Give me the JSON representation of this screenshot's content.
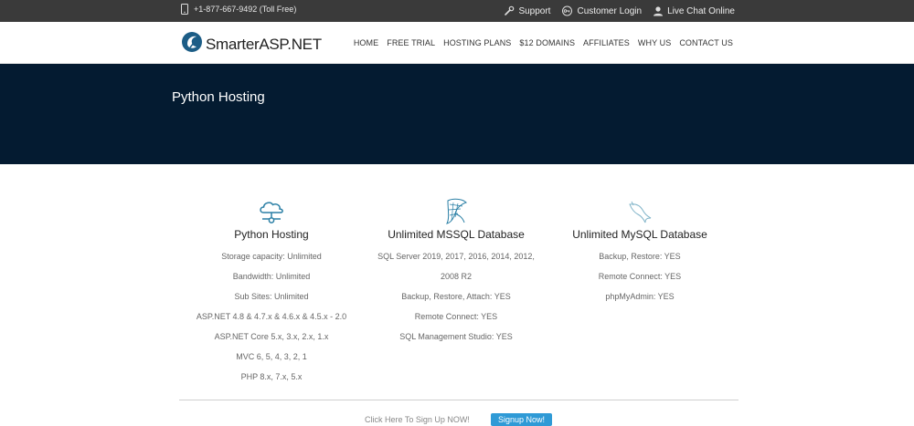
{
  "topbar": {
    "phone": "+1-877-667-9492 (Toll Free)",
    "links": [
      {
        "label": "Support",
        "icon": "wrench-icon"
      },
      {
        "label": "Customer Login",
        "icon": "key-icon"
      },
      {
        "label": "Live Chat Online",
        "icon": "user-icon"
      }
    ]
  },
  "header": {
    "logo_text": "SmarterASP.NET",
    "nav": [
      "HOME",
      "FREE TRIAL",
      "HOSTING PLANS",
      "$12 DOMAINS",
      "AFFILIATES",
      "WHY US",
      "CONTACT US"
    ]
  },
  "hero": {
    "title": "Python Hosting"
  },
  "columns": [
    {
      "title": "Python Hosting",
      "icon": "cloud-network-icon",
      "features": [
        "Storage capacity: Unlimited",
        "Bandwidth: Unlimited",
        "Sub Sites: Unlimited",
        "ASP.NET 4.8 & 4.7.x & 4.6.x & 4.5.x - 2.0",
        "ASP.NET Core 5.x, 3.x, 2.x, 1.x",
        "MVC 6, 5, 4, 3, 2, 1",
        "PHP 8.x, 7.x, 5.x"
      ]
    },
    {
      "title": "Unlimited MSSQL Database",
      "icon": "sql-server-icon",
      "features": [
        "SQL Server 2019, 2017, 2016, 2014, 2012,",
        "2008 R2",
        "Backup, Restore, Attach: YES",
        "Remote Connect: YES",
        "SQL Management Studio: YES"
      ]
    },
    {
      "title": "Unlimited MySQL Database",
      "icon": "mysql-dolphin-icon",
      "features": [
        "Backup, Restore: YES",
        "Remote Connect: YES",
        "phpMyAdmin: YES"
      ]
    }
  ],
  "signup": {
    "text": "Click Here To Sign Up NOW!",
    "button": "Signup Now!"
  },
  "colors": {
    "topbar": "#3a3a3a",
    "hero": "#041b31",
    "accent": "#2f9ad6",
    "icon": "#2a7fa5"
  }
}
